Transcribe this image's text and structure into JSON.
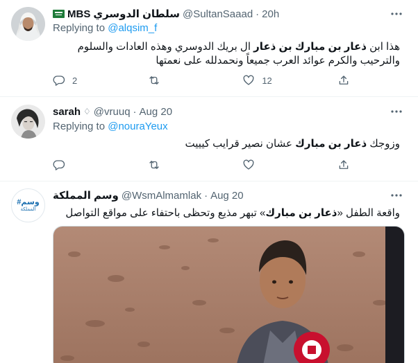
{
  "tweets": [
    {
      "name": "سلطان الدوسري",
      "name_suffix": "MBS",
      "handle": "@SultanSaaad",
      "dot": "·",
      "time": "20h",
      "replying_prefix": "Replying to",
      "replying_to": "@alqsim_f",
      "text_a": "هذا ابن ",
      "text_bold": "ذعار بن مبارك بن ذعار",
      "text_b": " ال بريك الدوسري وهذه العادات والسلوم والترحيب والكرم عوائد العرب جميعاً ونحمدلله على نعمتها",
      "replies": "2",
      "retweets": "",
      "likes": "12"
    },
    {
      "name": "sarah",
      "name_symbol": "♢",
      "handle": "@vruuq",
      "dot": "·",
      "time": "Aug 20",
      "replying_prefix": "Replying to",
      "replying_to": "@nouraYeux",
      "text_a": "وزوجك ",
      "text_bold": "ذعار بن مبارك",
      "text_b": " عشان نصير قرايب كيييت",
      "replies": "",
      "retweets": "",
      "likes": ""
    },
    {
      "name": "وسم المملكة",
      "handle": "@WsmAlmamlak",
      "dot": "·",
      "time": "Aug 20",
      "avatar_text": "#وسم",
      "avatar_sub": "المملكة",
      "text_a": "واقعة الطفل «",
      "text_bold": "ذعار بن مبارك",
      "text_b": "» تبهر مذيع وتحظى باحتفاء على مواقع التواصل"
    }
  ],
  "icons": {
    "more": "more-horizontal-icon",
    "reply": "reply-icon",
    "retweet": "retweet-icon",
    "like": "heart-icon",
    "share": "share-icon",
    "flag": "saudi-flag-icon"
  },
  "colors": {
    "link": "#1d9bf0",
    "secondary": "#536471",
    "divider": "#eff3f4"
  }
}
